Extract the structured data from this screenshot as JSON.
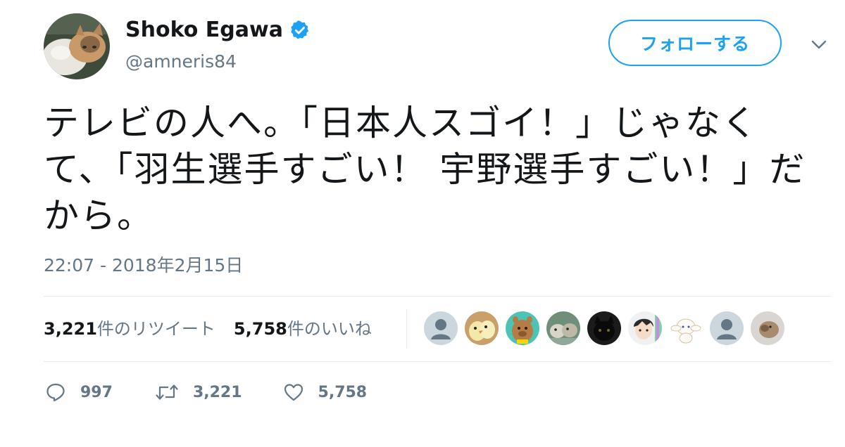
{
  "user": {
    "display_name": "Shoko Egawa",
    "handle": "@amneris84",
    "verified": true,
    "avatar_icon": "cat-avatar-photo"
  },
  "follow_button_label": "フォローする",
  "tweet": {
    "text": "テレビの人へ。「日本人スゴイ！」じゃなくて、「羽生選手すごい！ 宇野選手すごい！」だから。",
    "timestamp": "22:07 - 2018年2月15日"
  },
  "stats": {
    "retweets_count": "3,221",
    "retweets_label": "件のリツイート",
    "likes_count": "5,758",
    "likes_label": "件のいいね"
  },
  "likers": [
    "default-profile-icon",
    "bird-photo-icon",
    "capybara-icon",
    "hamster-photo-icon",
    "black-cat-photo-icon",
    "anime-character-icon",
    "cinnamoroll-icon",
    "default-profile-icon",
    "animal-photo-icon"
  ],
  "actions": {
    "replies": "997",
    "retweets": "3,221",
    "likes": "5,758"
  },
  "colors": {
    "accent": "#1da1f2",
    "text_primary": "#14171a",
    "text_secondary": "#657786",
    "divider": "#e6ecf0"
  }
}
